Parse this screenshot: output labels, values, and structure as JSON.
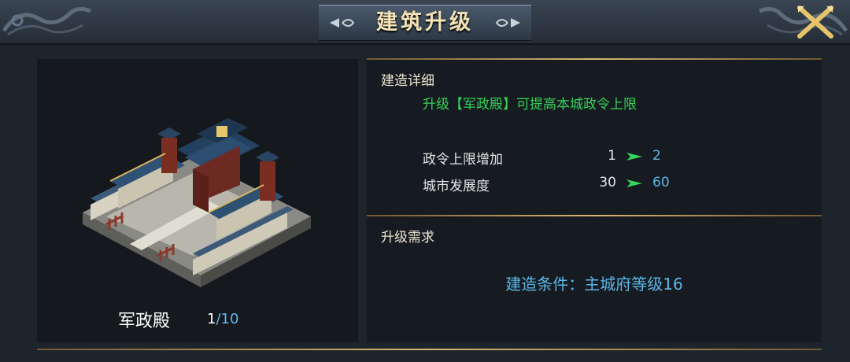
{
  "header": {
    "title": "建筑升级"
  },
  "building": {
    "name": "军政殿",
    "level": "1",
    "max_level": "/10"
  },
  "detail": {
    "section_title": "建造详细",
    "description": "升级【军政殿】可提高本城政令上限",
    "stats": [
      {
        "label": "政令上限增加",
        "from": "1",
        "to": "2"
      },
      {
        "label": "城市发展度",
        "from": "30",
        "to": "60"
      }
    ]
  },
  "requirements": {
    "section_title": "升级需求",
    "condition": "建造条件：主城府等级16"
  },
  "colors": {
    "gold": "#d7b774",
    "green": "#37d25a",
    "blue": "#5cb6e8",
    "title": "#f3e2b5"
  },
  "icons": {
    "close": "crossed-swords-icon",
    "arrow": "green-arrow-icon"
  }
}
